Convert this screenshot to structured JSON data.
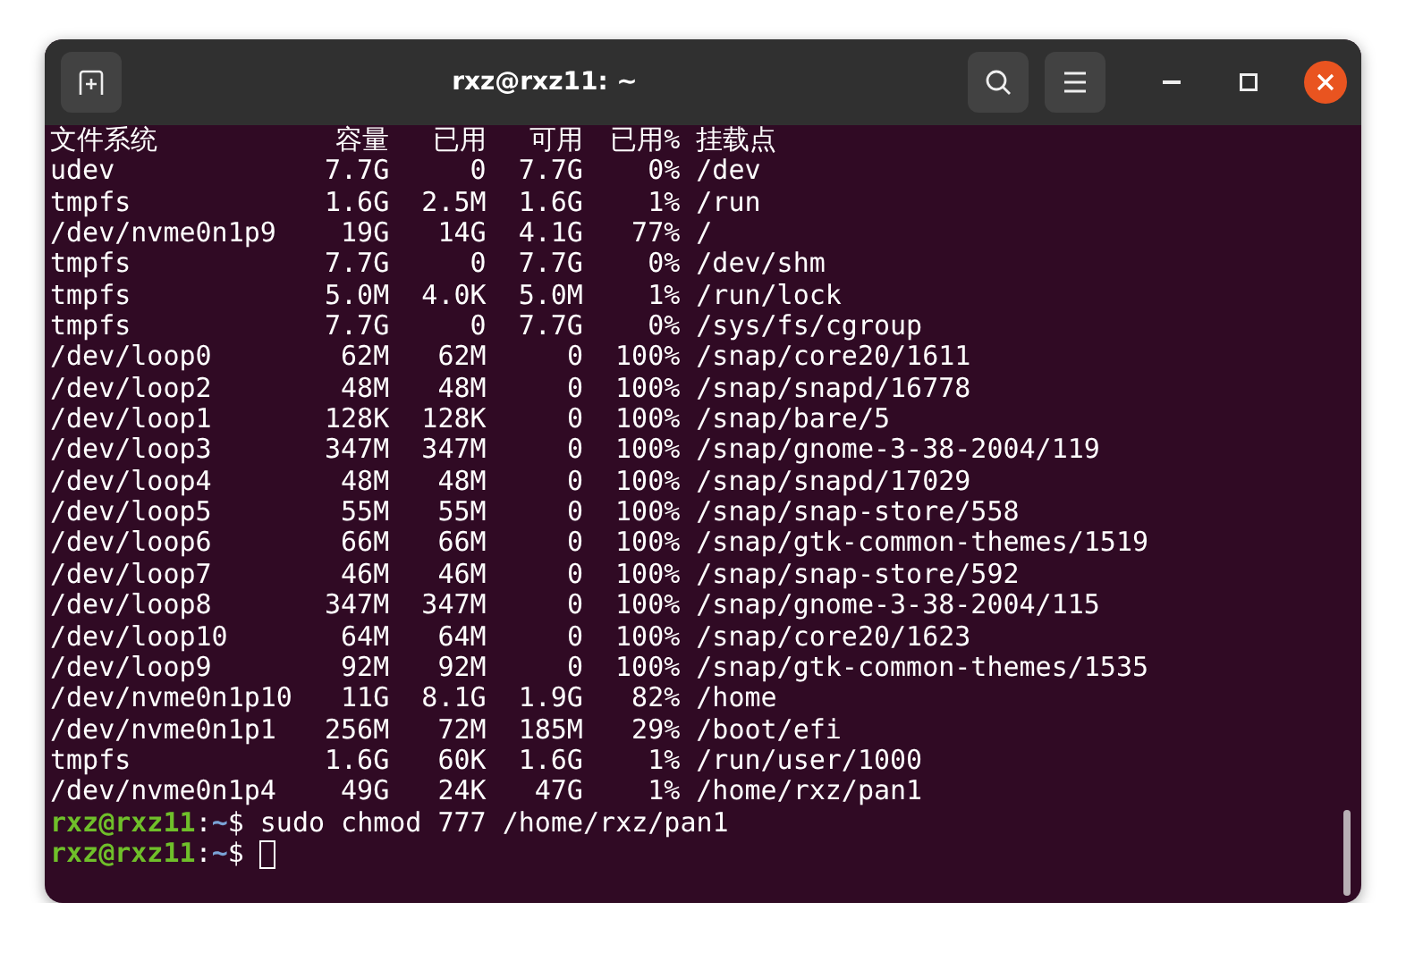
{
  "window": {
    "title": "rxz@rxz11: ~"
  },
  "df": {
    "columns": [
      "文件系统",
      "容量",
      "已用",
      "可用",
      "已用%",
      "挂载点"
    ],
    "rows": [
      [
        "udev",
        "7.7G",
        "0",
        "7.7G",
        "0%",
        "/dev"
      ],
      [
        "tmpfs",
        "1.6G",
        "2.5M",
        "1.6G",
        "1%",
        "/run"
      ],
      [
        "/dev/nvme0n1p9",
        "19G",
        "14G",
        "4.1G",
        "77%",
        "/"
      ],
      [
        "tmpfs",
        "7.7G",
        "0",
        "7.7G",
        "0%",
        "/dev/shm"
      ],
      [
        "tmpfs",
        "5.0M",
        "4.0K",
        "5.0M",
        "1%",
        "/run/lock"
      ],
      [
        "tmpfs",
        "7.7G",
        "0",
        "7.7G",
        "0%",
        "/sys/fs/cgroup"
      ],
      [
        "/dev/loop0",
        "62M",
        "62M",
        "0",
        "100%",
        "/snap/core20/1611"
      ],
      [
        "/dev/loop2",
        "48M",
        "48M",
        "0",
        "100%",
        "/snap/snapd/16778"
      ],
      [
        "/dev/loop1",
        "128K",
        "128K",
        "0",
        "100%",
        "/snap/bare/5"
      ],
      [
        "/dev/loop3",
        "347M",
        "347M",
        "0",
        "100%",
        "/snap/gnome-3-38-2004/119"
      ],
      [
        "/dev/loop4",
        "48M",
        "48M",
        "0",
        "100%",
        "/snap/snapd/17029"
      ],
      [
        "/dev/loop5",
        "55M",
        "55M",
        "0",
        "100%",
        "/snap/snap-store/558"
      ],
      [
        "/dev/loop6",
        "66M",
        "66M",
        "0",
        "100%",
        "/snap/gtk-common-themes/1519"
      ],
      [
        "/dev/loop7",
        "46M",
        "46M",
        "0",
        "100%",
        "/snap/snap-store/592"
      ],
      [
        "/dev/loop8",
        "347M",
        "347M",
        "0",
        "100%",
        "/snap/gnome-3-38-2004/115"
      ],
      [
        "/dev/loop10",
        "64M",
        "64M",
        "0",
        "100%",
        "/snap/core20/1623"
      ],
      [
        "/dev/loop9",
        "92M",
        "92M",
        "0",
        "100%",
        "/snap/gtk-common-themes/1535"
      ],
      [
        "/dev/nvme0n1p10",
        "11G",
        "8.1G",
        "1.9G",
        "82%",
        "/home"
      ],
      [
        "/dev/nvme0n1p1",
        "256M",
        "72M",
        "185M",
        "29%",
        "/boot/efi"
      ],
      [
        "tmpfs",
        "1.6G",
        "60K",
        "1.6G",
        "1%",
        "/run/user/1000"
      ],
      [
        "/dev/nvme0n1p4",
        "49G",
        "24K",
        "47G",
        "1%",
        "/home/rxz/pan1"
      ]
    ]
  },
  "prompts": [
    {
      "user_host": "rxz@rxz11",
      "separator": ":",
      "path": "~",
      "symbol": "$",
      "command": "sudo chmod 777 /home/rxz/pan1",
      "cursor": false
    },
    {
      "user_host": "rxz@rxz11",
      "separator": ":",
      "path": "~",
      "symbol": "$",
      "cursor": true
    }
  ]
}
